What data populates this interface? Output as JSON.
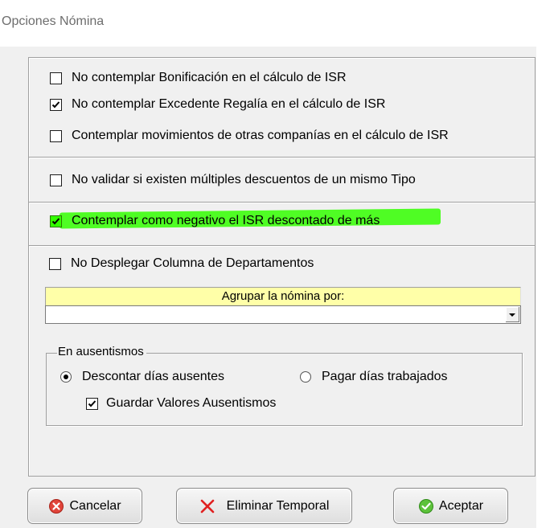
{
  "window": {
    "title": "Opciones Nómina"
  },
  "options": {
    "bonificacion": {
      "label": "No contemplar Bonificación en el cálculo de ISR",
      "checked": false
    },
    "regalia": {
      "label": "No contemplar Excedente Regalía en el cálculo de ISR",
      "checked": true
    },
    "otras_companias": {
      "label": "Contemplar movimientos de otras companías en el cálculo de ISR",
      "checked": false
    },
    "multiples_descuentos": {
      "label": "No validar si existen múltiples descuentos de un mismo Tipo",
      "checked": false
    },
    "isr_negativo": {
      "label": "Contemplar como negativo el ISR descontado de más",
      "checked": true,
      "highlighted": true,
      "highlight_color": "#33ff00"
    },
    "departamentos": {
      "label": "No Desplegar Columna de Departamentos",
      "checked": false
    }
  },
  "agrupar": {
    "label": "Agrupar la nómina por:",
    "value": ""
  },
  "ausentismos": {
    "legend": "En ausentismos",
    "radio_descontar": {
      "label": "Descontar días ausentes",
      "selected": true
    },
    "radio_pagar": {
      "label": "Pagar días trabajados",
      "selected": false
    },
    "guardar": {
      "label": "Guardar Valores Ausentismos",
      "checked": true
    }
  },
  "buttons": {
    "cancel": {
      "label": "Cancelar",
      "icon": "cancel-icon"
    },
    "delete_temp": {
      "label": "Eliminar Temporal",
      "icon": "x-icon"
    },
    "accept": {
      "label": "Aceptar",
      "icon": "check-icon"
    }
  },
  "colors": {
    "group_label_bg": "#ffffa8",
    "panel_bg": "#f0f0f0"
  }
}
